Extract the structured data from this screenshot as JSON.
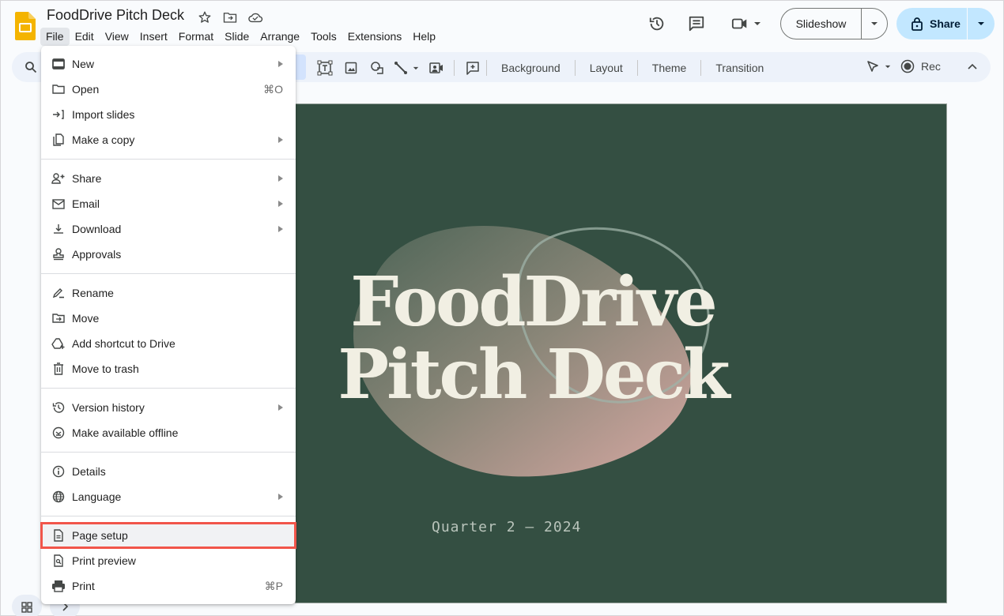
{
  "app": {
    "title": "FoodDrive Pitch Deck",
    "brand_color": "#f4b400",
    "icons": [
      "star-icon",
      "move-to-folder-icon",
      "cloud-saved-icon"
    ]
  },
  "menubar": [
    "File",
    "Edit",
    "View",
    "Insert",
    "Format",
    "Slide",
    "Arrange",
    "Tools",
    "Extensions",
    "Help"
  ],
  "menubar_active": "File",
  "header": {
    "slideshow_label": "Slideshow",
    "share_label": "Share",
    "share_color": "#c2e7ff"
  },
  "toolbar": {
    "text_buttons": [
      "Background",
      "Layout",
      "Theme",
      "Transition"
    ],
    "rec_label": "Rec"
  },
  "file_menu": {
    "groups": [
      [
        {
          "label": "New",
          "icon": "new-slides-icon",
          "submenu": true
        },
        {
          "label": "Open",
          "icon": "folder-icon",
          "shortcut": "⌘O"
        },
        {
          "label": "Import slides",
          "icon": "import-icon"
        },
        {
          "label": "Make a copy",
          "icon": "copy-icon",
          "submenu": true
        }
      ],
      [
        {
          "label": "Share",
          "icon": "person-add-icon",
          "submenu": true
        },
        {
          "label": "Email",
          "icon": "mail-icon",
          "submenu": true
        },
        {
          "label": "Download",
          "icon": "download-icon",
          "submenu": true
        },
        {
          "label": "Approvals",
          "icon": "approvals-stamp-icon"
        }
      ],
      [
        {
          "label": "Rename",
          "icon": "rename-pencil-icon"
        },
        {
          "label": "Move",
          "icon": "move-folder-icon"
        },
        {
          "label": "Add shortcut to Drive",
          "icon": "drive-shortcut-icon"
        },
        {
          "label": "Move to trash",
          "icon": "trash-icon"
        }
      ],
      [
        {
          "label": "Version history",
          "icon": "history-icon",
          "submenu": true
        },
        {
          "label": "Make available offline",
          "icon": "offline-icon"
        }
      ],
      [
        {
          "label": "Details",
          "icon": "info-icon"
        },
        {
          "label": "Language",
          "icon": "globe-icon",
          "submenu": true
        }
      ],
      [
        {
          "label": "Page setup",
          "icon": "page-icon",
          "highlighted": true
        },
        {
          "label": "Print preview",
          "icon": "print-preview-icon"
        },
        {
          "label": "Print",
          "icon": "printer-icon",
          "shortcut": "⌘P"
        }
      ]
    ],
    "highlight_color": "#f1554a"
  },
  "slide": {
    "title_line1": "FoodDrive",
    "title_line2": "Pitch Deck",
    "subtitle": "Quarter 2 — 2024",
    "background_color": "#344f42",
    "title_color": "#f1efe3"
  }
}
